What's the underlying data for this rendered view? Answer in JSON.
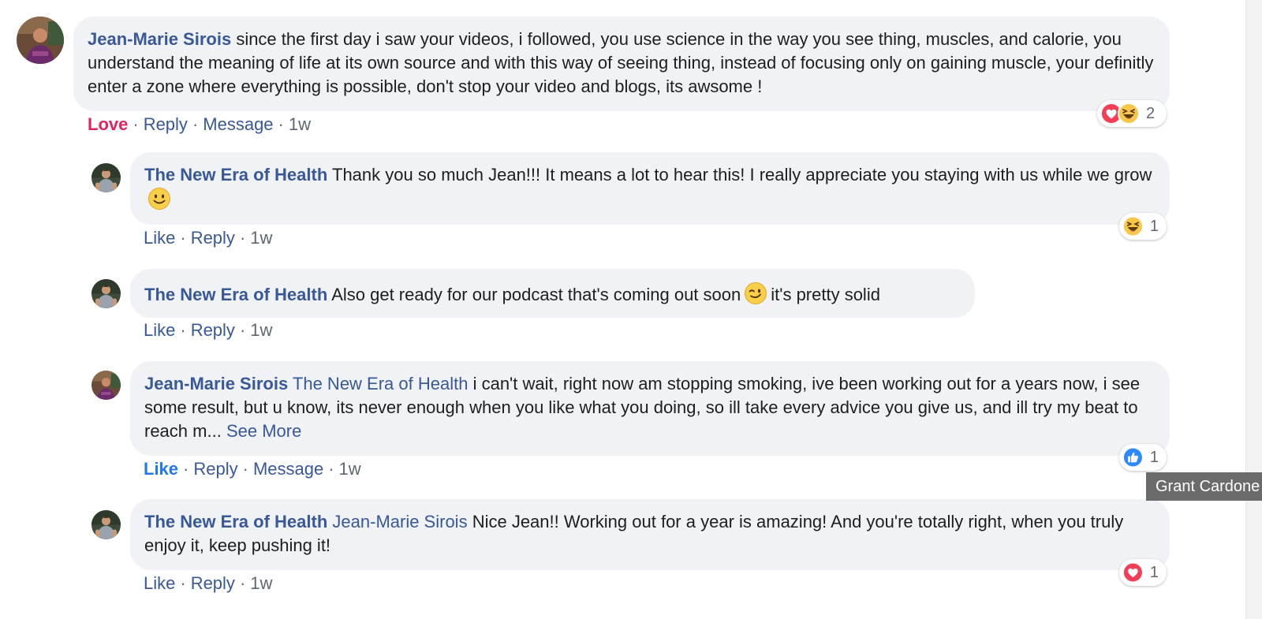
{
  "comments": [
    {
      "author": "Jean-Marie Sirois",
      "text": "since the first day i saw your videos, i followed, you use science in the way you see thing, muscles, and calorie, you understand the meaning of life at its own source and with this way of seeing thing, instead of focusing only on gaining muscle, your definitly enter a zone where everything is possible, don't stop your video and blogs, its awsome !",
      "actions": {
        "reaction": "Love",
        "reply": "Reply",
        "message": "Message",
        "time": "1w"
      },
      "reactions": {
        "icons": [
          "heart-icon",
          "laughing-emoji-icon"
        ],
        "count": "2"
      }
    },
    {
      "author": "The New Era of Health",
      "text_before": "Thank you so much Jean!!! It means a lot to hear this! I really appreciate you staying with us while we grow",
      "emoji": "smiling-emoji-icon",
      "actions": {
        "like": "Like",
        "reply": "Reply",
        "time": "1w"
      },
      "reactions": {
        "icons": [
          "laughing-emoji-icon"
        ],
        "count": "1"
      }
    },
    {
      "author": "The New Era of Health",
      "text_before": "Also get ready for our podcast that's coming out soon",
      "emoji": "winking-emoji-icon",
      "text_after": "it's pretty solid",
      "actions": {
        "like": "Like",
        "reply": "Reply",
        "time": "1w"
      }
    },
    {
      "author": "Jean-Marie Sirois",
      "mention": "The New Era of Health",
      "text": "i can't wait, right now am stopping smoking, ive been working out for a years now, i see some result, but u know, its never enough when you like what you doing, so ill take every advice you give us, and ill try my beat to reach m...",
      "see_more": "See More",
      "actions": {
        "like": "Like",
        "reply": "Reply",
        "message": "Message",
        "time": "1w"
      },
      "reactions": {
        "icons": [
          "thumbs-up-icon"
        ],
        "count": "1"
      }
    },
    {
      "author": "The New Era of Health",
      "mention": "Jean-Marie Sirois",
      "text": "Nice Jean!! Working out for a year is amazing! And you're totally right, when you truly enjoy it, keep pushing it!",
      "actions": {
        "like": "Like",
        "reply": "Reply",
        "time": "1w"
      },
      "reactions": {
        "icons": [
          "heart-icon"
        ],
        "count": "1"
      }
    }
  ],
  "tooltip": "Grant Cardone",
  "colors": {
    "link": "#385898",
    "love": "#e0245e",
    "like_active": "#2078f4",
    "bubble": "#f0f2f5",
    "meta": "#606770"
  }
}
